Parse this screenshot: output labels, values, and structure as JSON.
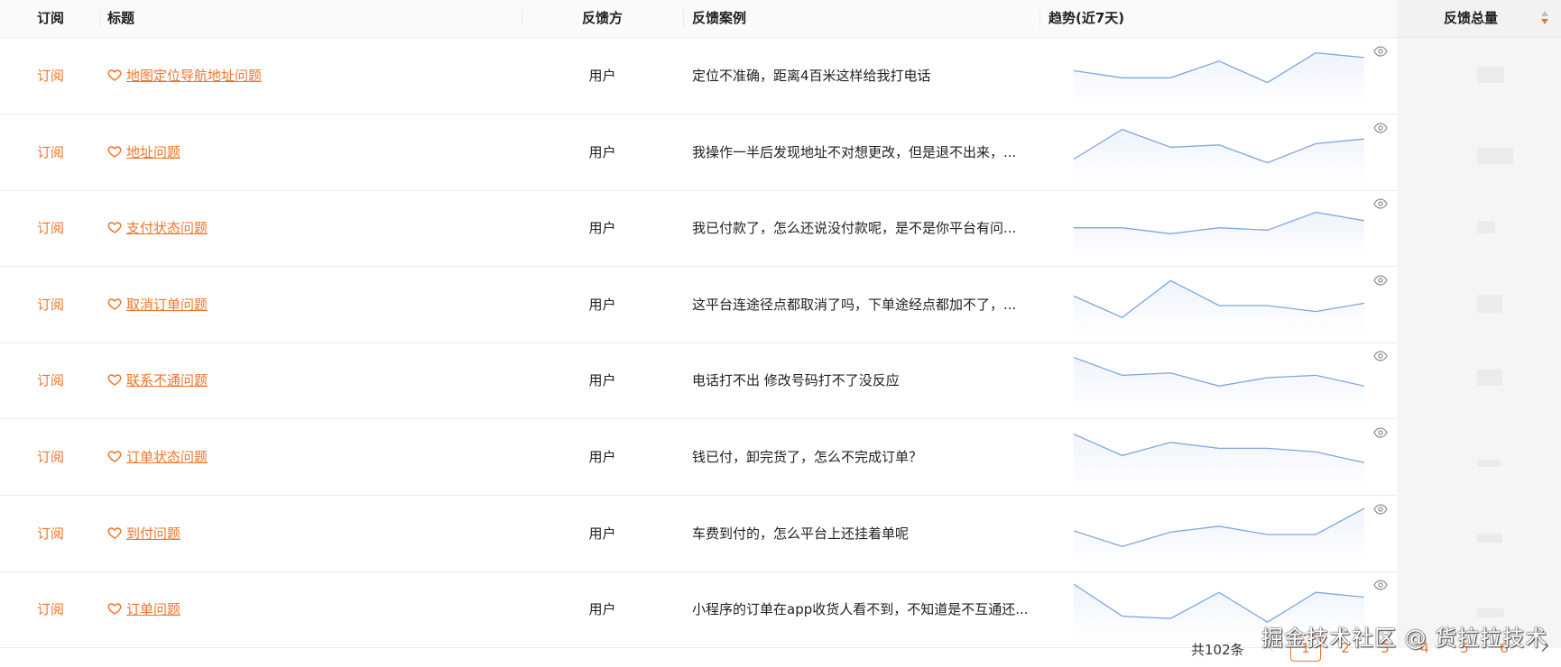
{
  "headers": {
    "subscribe": "订阅",
    "title": "标题",
    "party": "反馈方",
    "case": "反馈案例",
    "trend": "趋势(近7天)",
    "total": "反馈总量"
  },
  "rows": [
    {
      "subscribe": "订阅",
      "title": "地图定位导航地址问题",
      "party": "用户",
      "case": "定位不准确，距离4百米这样给我打电话",
      "trend": [
        60,
        48,
        48,
        76,
        40,
        90,
        82
      ]
    },
    {
      "subscribe": "订阅",
      "title": "地址问题",
      "party": "用户",
      "case": "我操作一半后发现地址不对想更改，但是退不出来，...",
      "trend": [
        40,
        90,
        60,
        64,
        34,
        66,
        74
      ]
    },
    {
      "subscribe": "订阅",
      "title": "支付状态问题",
      "party": "用户",
      "case": "我已付款了，怎么还说没付款呢，是不是你平台有问...",
      "trend": [
        52,
        52,
        42,
        52,
        48,
        78,
        64
      ]
    },
    {
      "subscribe": "订阅",
      "title": "取消订单问题",
      "party": "用户",
      "case": "这平台连途径点都取消了吗，下单途经点都加不了，...",
      "trend": [
        66,
        30,
        92,
        50,
        50,
        40,
        54
      ]
    },
    {
      "subscribe": "订阅",
      "title": "联系不通问题",
      "party": "用户",
      "case": "电话打不出 修改号码打不了没反应",
      "trend": [
        90,
        60,
        64,
        42,
        56,
        60,
        42
      ]
    },
    {
      "subscribe": "订阅",
      "title": "订单状态问题",
      "party": "用户",
      "case": "钱已付，卸完货了，怎么不完成订单？",
      "trend": [
        90,
        54,
        76,
        66,
        66,
        60,
        42
      ]
    },
    {
      "subscribe": "订阅",
      "title": "到付问题",
      "party": "用户",
      "case": "车费到付的，怎么平台上还挂着单呢",
      "trend": [
        56,
        30,
        54,
        64,
        50,
        50,
        94
      ]
    },
    {
      "subscribe": "订阅",
      "title": "订单问题",
      "party": "用户",
      "case": "小程序的订单在app收货人看不到，不知道是不互通还...",
      "trend": [
        94,
        40,
        36,
        80,
        30,
        80,
        72
      ]
    }
  ],
  "footer": {
    "total_text": "共102条",
    "pages": [
      "1",
      "2",
      "3",
      "4",
      "5",
      "6"
    ],
    "active_page": "1"
  },
  "watermark": "掘金技术社区 @ 货拉拉技术",
  "colors": {
    "accent": "#f0752a",
    "trend_line": "#7ea6e0",
    "trend_fill": "#eef4fc"
  }
}
